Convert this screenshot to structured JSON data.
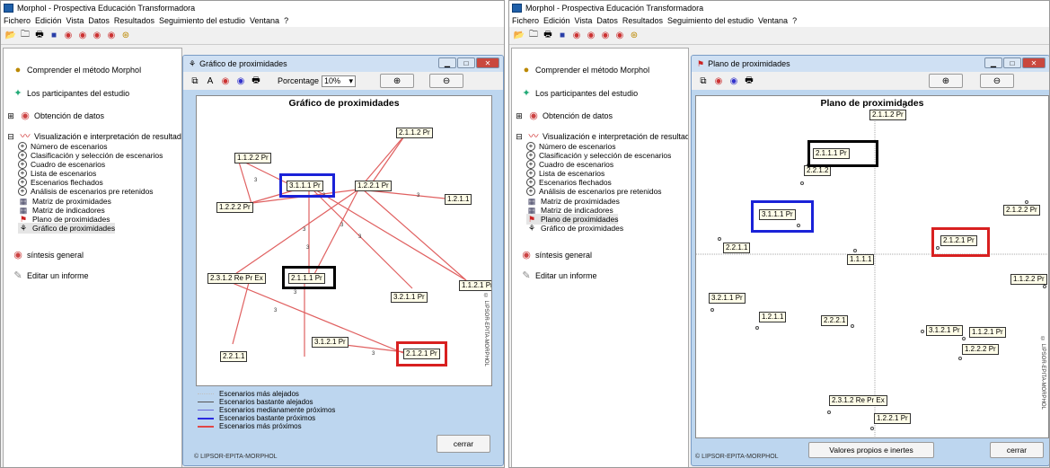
{
  "left": {
    "title": "Morphol  -  Prospectiva Educación Transformadora",
    "menu": [
      "Fichero",
      "Edición",
      "Vista",
      "Datos",
      "Resultados",
      "Seguimiento del estudio",
      "Ventana",
      "?"
    ],
    "tree": {
      "comprender": "Comprender el método Morphol",
      "participantes": "Los participantes del estudio",
      "obtencion": "Obtención de datos",
      "visualizacion": "Visualización e interpretación de resultados",
      "subs": [
        "Número de escenarios",
        "Clasificación y selección de escenarios",
        "Cuadro de escenarios",
        "Lista de escenarios",
        "Escenarios flechados",
        "Análisis de escenarios pre retenidos",
        "Matriz de proximidades",
        "Matriz de indicadores",
        "Plano de proximidades",
        "Gráfico de proximidades"
      ],
      "sintesis": "síntesis general",
      "informe": "Editar un informe"
    },
    "window": {
      "title": "Gráfico de proximidades",
      "porcentage_label": "Porcentage",
      "porcentage_value": "10%",
      "chart_title": "Gráfico de proximidades",
      "credit": "© LIPSOR-EPITA-MORPHOL",
      "vertical_credit": "© LIPSOR-EPITA-MORPHOL",
      "close": "cerrar"
    },
    "legend": [
      {
        "label": "Escenarios más alejados",
        "color": "#c0c0c0",
        "style": "dotted"
      },
      {
        "label": "Escenarios bastante alejados",
        "color": "#555555",
        "style": "solid"
      },
      {
        "label": "Escenarios medianamente próximos",
        "color": "#6a6ad8",
        "style": "solid"
      },
      {
        "label": "Escenarios bastante próximos",
        "color": "#2a2ae0",
        "style": "solid"
      },
      {
        "label": "Escenarios más próximos",
        "color": "#e04848",
        "style": "solid"
      }
    ],
    "graph_labels": [
      "2.1.1.2 Pr",
      "1.1.2.2 Pr",
      "3.1.1.1 Pr",
      "1.2.2.1 Pr",
      "1.2.1.1",
      "1.2.2.2 Pr",
      "2.3.1.2 Re Pr Ex",
      "2.1.1.1 Pr",
      "1.1.2.1 Pr",
      "3.2.1.1 Pr",
      "3.1.2.1 Pr",
      "2.2.1.1",
      "2.1.2.1 Pr"
    ],
    "edge_weight": "3"
  },
  "right": {
    "title": "Morphol  -  Prospectiva Educación Transformadora",
    "menu": [
      "Fichero",
      "Edición",
      "Vista",
      "Datos",
      "Resultados",
      "Seguimiento del estudio",
      "Ventana",
      "?"
    ],
    "tree": {
      "comprender": "Comprender el método Morphol",
      "participantes": "Los participantes del estudio",
      "obtencion": "Obtención de datos",
      "visualizacion": "Visualización e interpretación de resultados",
      "subs": [
        "Número de escenarios",
        "Clasificación y selección de escenarios",
        "Cuadro de escenarios",
        "Lista de escenarios",
        "Escenarios flechados",
        "Análisis de escenarios pre retenidos",
        "Matriz de proximidades",
        "Matriz de indicadores",
        "Plano de proximidades",
        "Gráfico de proximidades"
      ],
      "sintesis": "síntesis general",
      "informe": "Editar un informe"
    },
    "window": {
      "title": "Plano de proximidades",
      "chart_title": "Plano de proximidades",
      "credit": "© LIPSOR-EPITA-MORPHOL",
      "vertical_credit": "© LIPSOR-EPITA-MORPHOL",
      "valores": "Valores propios e inertes",
      "close": "cerrar"
    },
    "plane_labels": [
      "2.1.1.2 Pr",
      "2.1.1.1 Pr",
      "2.2.1.2",
      "3.1.1.1 Pr",
      "2.2.1.1",
      "2.1.2.2 Pr",
      "2.1.2.1 Pr",
      "1.1.1.1",
      "1.1.2.2 Pr",
      "3.2.1.1 Pr",
      "1.2.1.1",
      "2.2.2.1",
      "3.1.2.1 Pr",
      "1.1.2.1 Pr",
      "1.2.2.2 Pr",
      "2.3.1.2 Re Pr Ex",
      "1.2.2.1 Pr"
    ]
  }
}
